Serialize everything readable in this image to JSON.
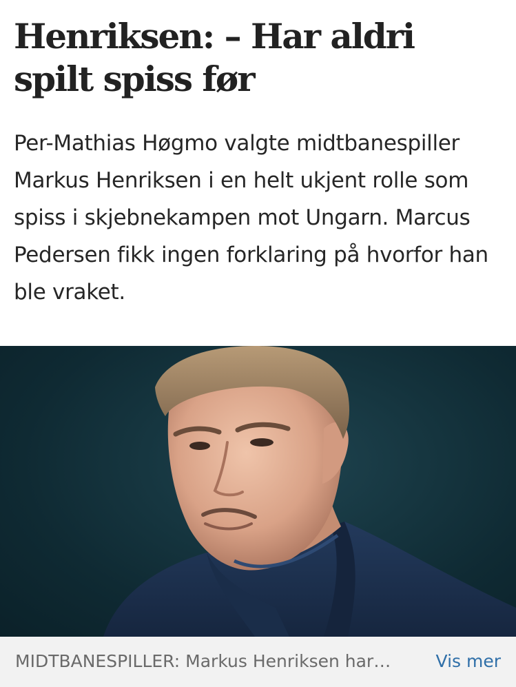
{
  "article": {
    "headline": "Henriksen: – Har aldri spilt spiss før",
    "lead": "Per-Mathias Høgmo valgte midtbanespiller Markus Henriksen i en helt ukjent rolle som spiss i skjebnekampen mot Ungarn. Marcus Pedersen fikk ingen forklaring på hvorfor han ble vraket.",
    "image": {
      "caption": "MIDTBANESPILLER: Markus Henriksen har…",
      "more_label": "Vis mer"
    }
  },
  "colors": {
    "background": "#ffffff",
    "caption_background": "#f2f2f2",
    "caption_text": "#6a6a6a",
    "link": "#2f6fa8",
    "photo_background": "#163640",
    "jacket": "#1d3150"
  }
}
